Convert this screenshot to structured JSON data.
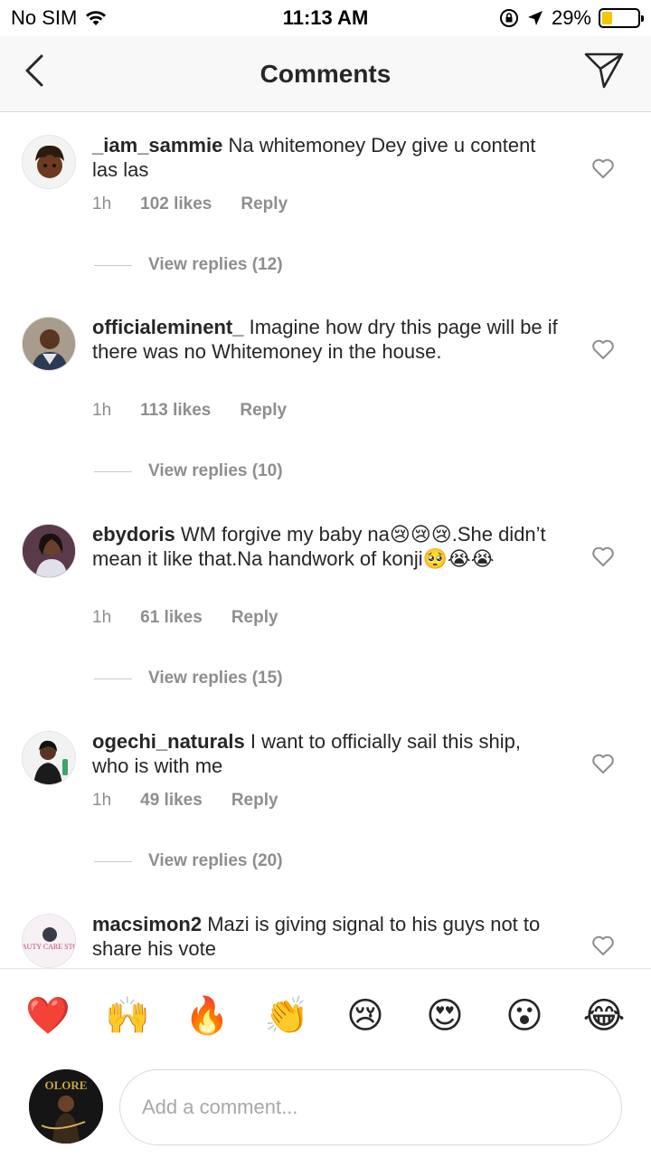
{
  "status_bar": {
    "carrier": "No SIM",
    "time": "11:13 AM",
    "battery": "29%",
    "battery_level": 0.29,
    "battery_color": "#f2c700"
  },
  "header": {
    "title": "Comments",
    "back_icon": "chevron-left-icon",
    "send_icon": "paper-plane-icon"
  },
  "comments": [
    {
      "username": "_iam_sammie",
      "text": "Na whitemoney Dey give u content las las",
      "time": "1h",
      "likes": "102 likes",
      "reply": "Reply",
      "view_replies": "View replies (12)"
    },
    {
      "username": "officialeminent_",
      "text": "Imagine how dry this page will be if there was no Whitemoney in the house.",
      "time": "1h",
      "likes": "113 likes",
      "reply": "Reply",
      "view_replies": "View replies (10)"
    },
    {
      "username": "ebydoris",
      "text": "WM forgive my baby na😢😢😢.She didn’t mean it like that.Na handwork of konji🥺😭😭",
      "time": "1h",
      "likes": "61 likes",
      "reply": "Reply",
      "view_replies": "View replies (15)"
    },
    {
      "username": "ogechi_naturals",
      "text": "I want to officially sail this ship, who is with me",
      "time": "1h",
      "likes": "49 likes",
      "reply": "Reply",
      "view_replies": "View replies (20)"
    },
    {
      "username": "macsimon2",
      "text": "Mazi is giving signal to his guys not to share his vote",
      "avatar_text": "AUTY CARE STO"
    }
  ],
  "emoji_bar": [
    "❤️",
    "🙌",
    "🔥",
    "👏",
    "😢",
    "😍",
    "😮",
    "😂"
  ],
  "input": {
    "placeholder": "Add a comment...",
    "avatar_text": "OLORE"
  }
}
